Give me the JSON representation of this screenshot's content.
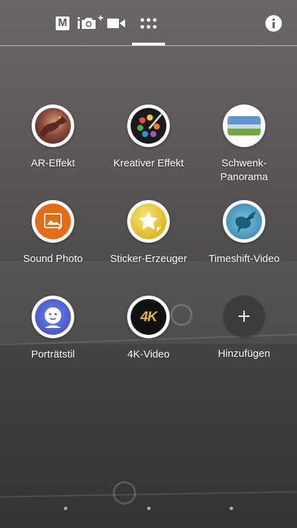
{
  "tabs": [
    {
      "id": "manual",
      "label": "M"
    },
    {
      "id": "photo",
      "label": "photo"
    },
    {
      "id": "video",
      "label": "video"
    },
    {
      "id": "apps",
      "label": "apps"
    }
  ],
  "apps": [
    {
      "label": "AR-Effekt",
      "icon": "ar-effect-icon"
    },
    {
      "label": "Kreativer Effekt",
      "icon": "palette-icon"
    },
    {
      "label": "Schwenk-\nPanorama",
      "icon": "panorama-icon"
    },
    {
      "label": "Sound Photo",
      "icon": "sound-photo-icon"
    },
    {
      "label": "Sticker-Erzeuger",
      "icon": "sticker-icon"
    },
    {
      "label": "Timeshift-Video",
      "icon": "hummingbird-icon"
    },
    {
      "label": "Porträtstil",
      "icon": "portrait-style-icon"
    },
    {
      "label": "4K-Video",
      "icon": "4k-icon"
    },
    {
      "label": "Hinzufügen",
      "icon": "add-icon"
    }
  ],
  "icon_4k_text": "4K",
  "pages": 3,
  "colors": {
    "active_indicator": "#ffffff",
    "label": "#ffffff"
  }
}
